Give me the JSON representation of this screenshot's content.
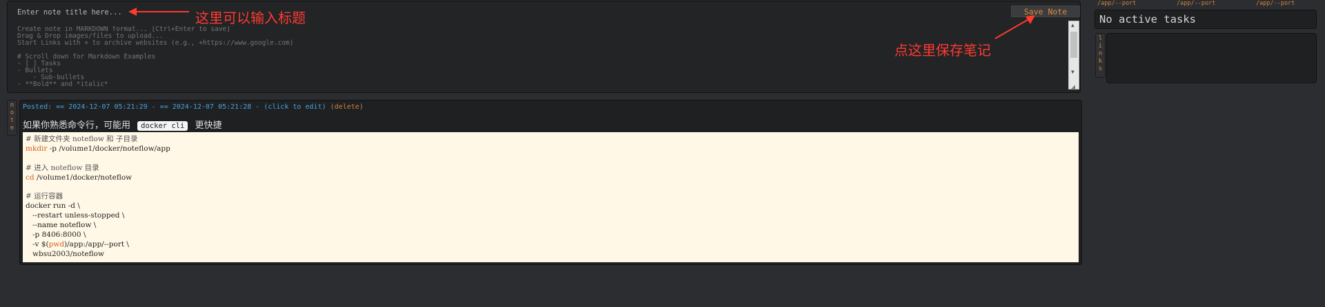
{
  "editor": {
    "title_placeholder": "Enter note title here...",
    "save_label": "Save Note",
    "body_placeholder": "Create note in MARKDOWN format... [Ctrl+Enter to save]\nDrag & Drop images/files to upload...\nStart Links with + to archive websites (e.g., +https://www.google.com)\n\n# Scroll down for Markdown Examples\n- [ ] Tasks\n- Bullets\n    - Sub-bullets\n- **Bold** and *italic*"
  },
  "annotations": {
    "title_hint": "这里可以输入标题",
    "save_hint": "点这里保存笔记"
  },
  "sidebar": {
    "port_links": [
      "/app/--port",
      "/app/--port",
      "/app/--port"
    ],
    "tasks_text": "No active tasks",
    "links_tab": [
      "l",
      "i",
      "n",
      "k",
      "s"
    ]
  },
  "note": {
    "side_tab": [
      "n",
      "o",
      "t",
      "e"
    ],
    "posted": "Posted: == 2024-12-07 05:21:29 - == 2024-12-07 05:21:28 - (click to edit)",
    "delete_label": "(delete)",
    "intro_before": "如果你熟悉命令行，可能用",
    "intro_code": "docker cli",
    "intro_after": "更快捷",
    "code": {
      "l1": "# 新建文件夹 noteflow 和 子目录",
      "l2_kw": "mkdir",
      "l2_rest": " -p /volume1/docker/noteflow/app",
      "l4": "# 进入 noteflow 目录",
      "l5_kw": "cd",
      "l5_rest": " /volume1/docker/noteflow",
      "l7": "# 运行容器",
      "l8": "docker run -d \\",
      "l9": "   --restart unless-stopped \\",
      "l10": "   --name noteflow \\",
      "l11": "   -p 8406:8000 \\",
      "l12_a": "   -v $(",
      "l12_kw": "pwd",
      "l12_b": ")/app:/app/--port \\",
      "l13": "   wbsu2003/noteflow"
    }
  },
  "colors": {
    "accent": "#d2843d",
    "link": "#4aa3df",
    "annotation": "#ff3a30",
    "code_bg": "#fff8e6"
  }
}
